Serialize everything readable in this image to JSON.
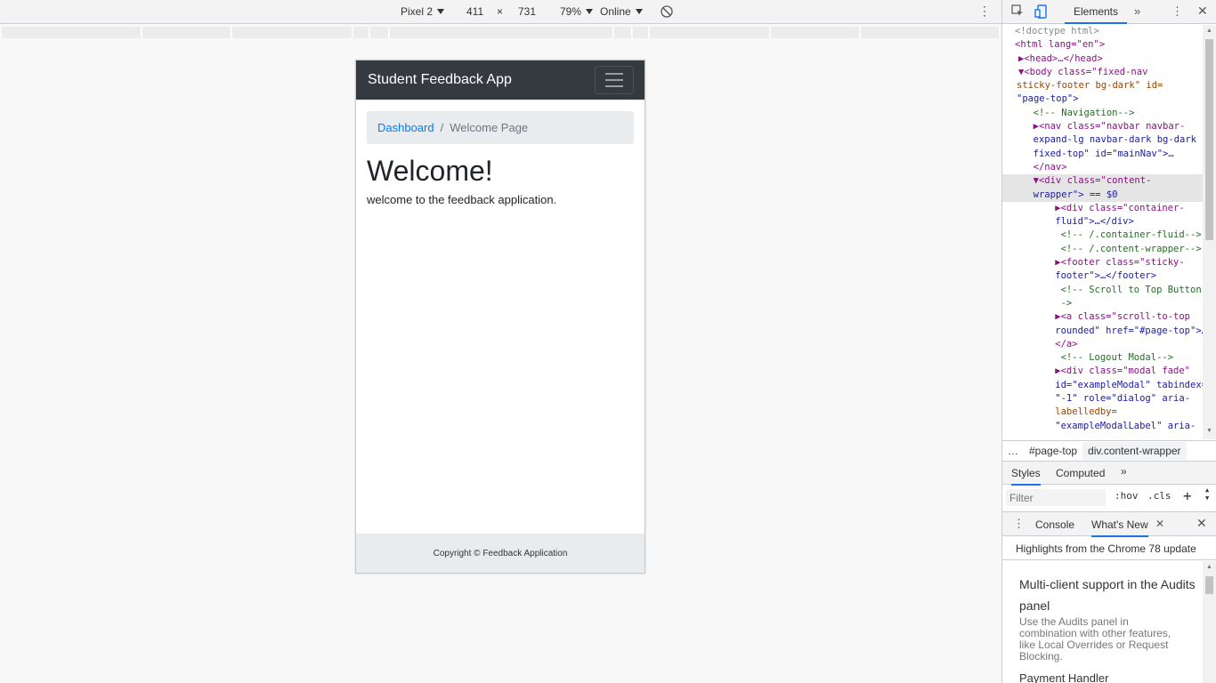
{
  "device_toolbar": {
    "device": "Pixel 2",
    "width": "411",
    "times": "×",
    "height": "731",
    "zoom": "79%",
    "network": "Online"
  },
  "app": {
    "brand": "Student Feedback App",
    "breadcrumb": {
      "link": "Dashboard",
      "separator": "/",
      "current": "Welcome Page"
    },
    "title": "Welcome!",
    "text": "welcome to the feedback application.",
    "footer": "Copyright © Feedback Application"
  },
  "devtools": {
    "panel_tab": "Elements",
    "code_lines": [
      "<!doctype html>",
      "<html lang=\"en\">",
      "▶<head>…</head>",
      "▼<body class=\"fixed-nav",
      "sticky-footer bg-dark\" id=",
      "\"page-top\">",
      "  <!-- Navigation-->",
      "  ▶<nav class=\"navbar navbar-",
      "  expand-lg navbar-dark bg-dark",
      "  fixed-top\" id=\"mainNav\">…",
      "  </nav>",
      "  ▼<div class=\"content-",
      "  wrapper\"> == $0",
      "    ▶<div class=\"container-",
      "    fluid\">…</div>",
      "     <!-- /.container-fluid-->",
      "     <!-- /.content-wrapper-->",
      "    ▶<footer class=\"sticky-",
      "    footer\">…</footer>",
      "     <!-- Scroll to Top Button-",
      "     ->",
      "    ▶<a class=\"scroll-to-top",
      "    rounded\" href=\"#page-top\">…",
      "    </a>",
      "     <!-- Logout Modal-->",
      "    ▶<div class=\"modal fade\"",
      "    id=\"exampleModal\" tabindex=",
      "    \"-1\" role=\"dialog\" aria-",
      "    labelledby=",
      "    \"exampleModalLabel\" aria-"
    ],
    "breadcrumbs": [
      "…",
      "#page-top",
      "div.content-wrapper"
    ],
    "styles_tabs": [
      "Styles",
      "Computed"
    ],
    "filter_placeholder": "Filter",
    "hov": ":hov",
    "cls": ".cls",
    "plus": "+",
    "drawer_tabs": [
      "Console",
      "What's New"
    ],
    "whats_new_header": "Highlights from the Chrome 78 update",
    "whats_new_title": "Multi-client support in the Audits panel",
    "whats_new_desc": "Use the Audits panel in combination with other features, like Local Overrides or Request Blocking.",
    "whats_new_title2": "Payment Handler"
  }
}
